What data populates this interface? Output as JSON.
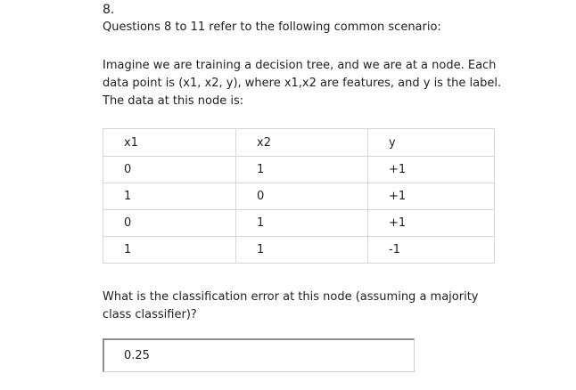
{
  "question_number": "8.",
  "scenario_heading": "Questions 8 to 11 refer to the following common scenario:",
  "scenario_lines": [
    "Imagine we are training a decision tree, and we are at a node. Each",
    "data point is (x1, x2, y), where x1,x2 are features, and y is the label.",
    "The data at this node is:"
  ],
  "table": {
    "headers": [
      "x1",
      "x2",
      "y"
    ],
    "rows": [
      [
        "0",
        "1",
        "+1"
      ],
      [
        "1",
        "0",
        "+1"
      ],
      [
        "0",
        "1",
        "+1"
      ],
      [
        "1",
        "1",
        "-1"
      ]
    ]
  },
  "question_lines": [
    "What is the classification error at this node (assuming a majority",
    "class classifier)?"
  ],
  "answer": {
    "value": "0.25"
  }
}
